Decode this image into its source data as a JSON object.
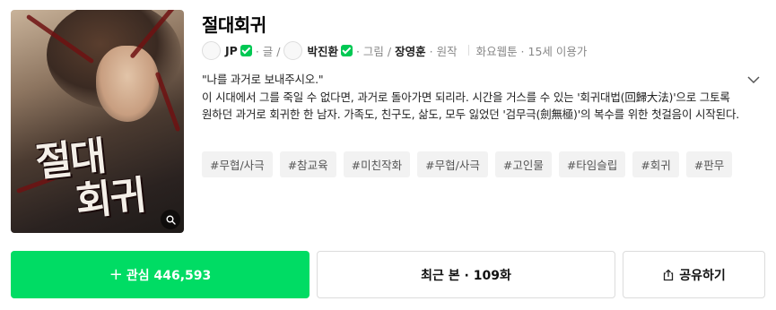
{
  "thumbnail": {
    "alt": "절대회귀 썸네일",
    "logo_line1": "절대",
    "logo_line2": "회귀",
    "zoom_icon": "search-icon"
  },
  "title": "절대회귀",
  "meta": {
    "author1": {
      "name": "JP",
      "role": "· 글 /",
      "verified": true
    },
    "author2": {
      "name": "박진환",
      "role": "· 그림 /",
      "verified": true
    },
    "author3": {
      "name": "장영훈",
      "role": "· 원작"
    },
    "info": "화요웹툰 · 15세 이용가"
  },
  "description": {
    "quote": "\"나를 과거로 보내주시오.\"",
    "body": "이 시대에서 그를 죽일 수 없다면, 과거로 돌아가면 되리라. 시간을 거스를 수 있는 '회귀대법(回歸大法)'으로 그토록 원하던 과거로 회귀한 한 남자. 가족도, 친구도, 삶도, 모두 잃었던 '검무극(劍無極)'의 복수를 위한 첫걸음이 시작된다.",
    "expand_icon": "chevron-down-icon"
  },
  "tags": [
    "#무협/사극",
    "#참교육",
    "#미친작화",
    "#무협/사극",
    "#고인물",
    "#타임슬립",
    "#회귀",
    "#판무"
  ],
  "buttons": {
    "favorite_label": "관심 446,593",
    "recent_label": "최근 본 · 109화",
    "share_label": "공유하기"
  },
  "colors": {
    "accent": "#00dc64",
    "verified": "#00c853",
    "tag_bg": "#f2f2f2"
  }
}
